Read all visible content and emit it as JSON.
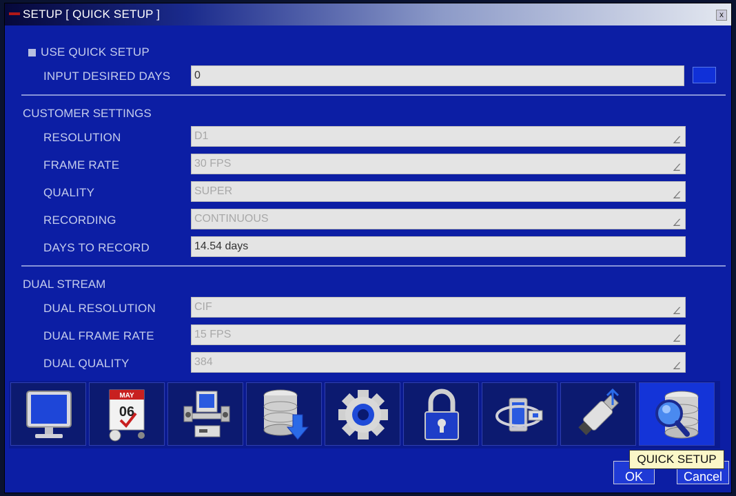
{
  "window": {
    "title": "SETUP [ QUICK SETUP ]",
    "close_label": "x"
  },
  "quick": {
    "use_label": "USE QUICK SETUP",
    "days_label": "INPUT DESIRED DAYS",
    "days_value": "0"
  },
  "customer": {
    "heading": "CUSTOMER SETTINGS",
    "resolution": {
      "label": "RESOLUTION",
      "value": "D1"
    },
    "frame_rate": {
      "label": "FRAME RATE",
      "value": "30 FPS"
    },
    "quality": {
      "label": "QUALITY",
      "value": "SUPER"
    },
    "recording": {
      "label": "RECORDING",
      "value": "CONTINUOUS"
    },
    "days": {
      "label": "DAYS TO RECORD",
      "value": "14.54 days"
    }
  },
  "dual": {
    "heading": "DUAL STREAM",
    "resolution": {
      "label": "DUAL RESOLUTION",
      "value": "CIF"
    },
    "frame_rate": {
      "label": "DUAL FRAME RATE",
      "value": "15 FPS"
    },
    "quality": {
      "label": "DUAL QUALITY",
      "value": "384"
    }
  },
  "toolbar": {
    "calendar_month": "MAY",
    "calendar_day": "06",
    "tooltip": "QUICK SETUP",
    "ok_label": "OK",
    "cancel_label": "Cancel",
    "icons": [
      "monitor-icon",
      "calendar-icon",
      "computer-icon",
      "database-download-icon",
      "gear-icon",
      "lock-icon",
      "network-icon",
      "usb-icon",
      "database-search-icon"
    ]
  }
}
